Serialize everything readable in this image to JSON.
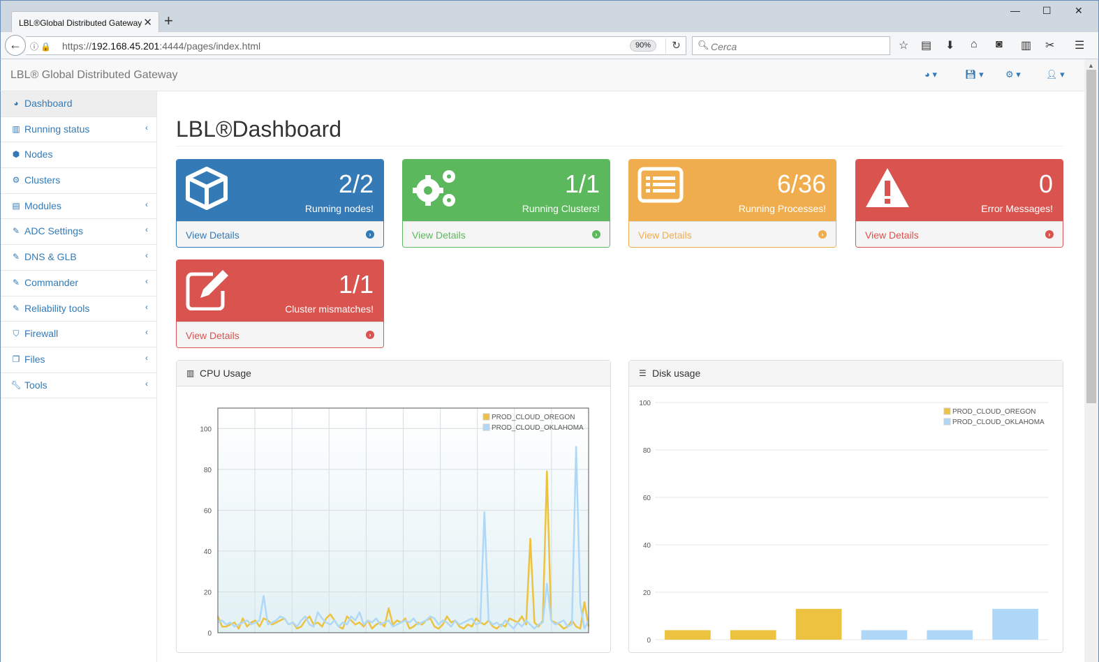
{
  "browser": {
    "tab_title": "LBL®Global Distributed Gateway",
    "url_scheme": "https://",
    "url_host": "192.168.45.201",
    "url_rest": ":4444/pages/index.html",
    "zoom": "90%",
    "search_placeholder": "Cerca"
  },
  "app": {
    "brand": "LBL® Global Distributed Gateway",
    "header_icons": [
      "dashboard-icon",
      "save-icon",
      "gear-icon",
      "user-icon"
    ]
  },
  "sidebar": {
    "items": [
      {
        "label": "Dashboard",
        "icon": "dashboard-icon",
        "submenu": false,
        "active": true
      },
      {
        "label": "Running status",
        "icon": "bar-chart-icon",
        "submenu": true
      },
      {
        "label": "Nodes",
        "icon": "cube-icon",
        "submenu": false
      },
      {
        "label": "Clusters",
        "icon": "cogs-icon",
        "submenu": false
      },
      {
        "label": "Modules",
        "icon": "list-alt-icon",
        "submenu": true
      },
      {
        "label": "ADC Settings",
        "icon": "edit-icon",
        "submenu": true
      },
      {
        "label": "DNS & GLB",
        "icon": "edit-icon",
        "submenu": true
      },
      {
        "label": "Commander",
        "icon": "edit-icon",
        "submenu": true
      },
      {
        "label": "Reliability tools",
        "icon": "edit-icon",
        "submenu": true
      },
      {
        "label": "Firewall",
        "icon": "shield-icon",
        "submenu": true
      },
      {
        "label": "Files",
        "icon": "copy-icon",
        "submenu": true
      },
      {
        "label": "Tools",
        "icon": "wrench-icon",
        "submenu": true
      }
    ]
  },
  "page": {
    "title": "LBL®Dashboard"
  },
  "panels": [
    {
      "count": "2/2",
      "label": "Running nodes!",
      "link": "View Details",
      "color": "#337ab7",
      "icon": "cube-icon"
    },
    {
      "count": "1/1",
      "label": "Running Clusters!",
      "link": "View Details",
      "color": "#5cb85c",
      "icon": "cogs-icon"
    },
    {
      "count": "6/36",
      "label": "Running Processes!",
      "link": "View Details",
      "color": "#f0ad4e",
      "icon": "list-alt-icon"
    },
    {
      "count": "0",
      "label": "Error Messages!",
      "link": "View Details",
      "color": "#d9534f",
      "icon": "warning-icon"
    },
    {
      "count": "1/1",
      "label": "Cluster mismatches!",
      "link": "View Details",
      "color": "#d9534f",
      "icon": "edit-icon"
    }
  ],
  "charts": {
    "cpu_title": "CPU Usage",
    "disk_title": "Disk usage"
  },
  "chart_data": [
    {
      "type": "line",
      "title": "CPU Usage",
      "ylim": [
        0,
        110
      ],
      "yticks": [
        0,
        20,
        40,
        60,
        80,
        100
      ],
      "grid": true,
      "legend": "top-right",
      "series": [
        {
          "name": "PROD_CLOUD_OREGON",
          "color": "#edc240",
          "values": [
            8,
            3,
            3,
            4,
            5,
            2,
            7,
            3,
            5,
            6,
            3,
            7,
            6,
            4,
            5,
            6,
            7,
            4,
            5,
            2,
            3,
            6,
            8,
            4,
            5,
            3,
            7,
            9,
            6,
            3,
            2,
            8,
            6,
            4,
            5,
            3,
            6,
            2,
            4,
            5,
            3,
            12,
            4,
            6,
            5,
            7,
            2,
            3,
            5,
            4,
            6,
            7,
            3,
            2,
            4,
            8,
            5,
            6,
            3,
            2,
            4,
            3,
            7,
            5,
            4,
            6,
            3,
            2,
            4,
            3,
            7,
            6,
            5,
            8,
            4,
            46,
            5,
            3,
            6,
            79,
            6,
            5,
            4,
            2,
            3,
            6,
            3,
            2,
            15,
            3
          ]
        },
        {
          "name": "PROD_CLOUD_OKLAHOMA",
          "color": "#afd8f8",
          "values": [
            5,
            6,
            4,
            5,
            3,
            4,
            5,
            6,
            4,
            5,
            6,
            18,
            4,
            5,
            6,
            8,
            7,
            4,
            5,
            3,
            6,
            8,
            4,
            3,
            10,
            7,
            5,
            4,
            6,
            3,
            5,
            4,
            8,
            6,
            10,
            4,
            6,
            5,
            7,
            4,
            5,
            6,
            3,
            4,
            5,
            6,
            5,
            7,
            4,
            5,
            6,
            8,
            7,
            4,
            6,
            5,
            3,
            6,
            4,
            5,
            6,
            7,
            4,
            5,
            59,
            6,
            4,
            5,
            3,
            6,
            4,
            2,
            5,
            3,
            6,
            4,
            2,
            4,
            5,
            24,
            6,
            4,
            5,
            6,
            3,
            4,
            91,
            14,
            2,
            6
          ]
        }
      ]
    },
    {
      "type": "bar",
      "title": "Disk usage",
      "ylim": [
        0,
        100
      ],
      "yticks": [
        0,
        20,
        40,
        60,
        80,
        100
      ],
      "grid": true,
      "legend": "top-right",
      "series": [
        {
          "name": "PROD_CLOUD_OREGON",
          "color": "#edc240",
          "values": [
            4,
            4,
            13
          ]
        },
        {
          "name": "PROD_CLOUD_OKLAHOMA",
          "color": "#afd8f8",
          "values": [
            4,
            4,
            13
          ]
        }
      ]
    }
  ]
}
